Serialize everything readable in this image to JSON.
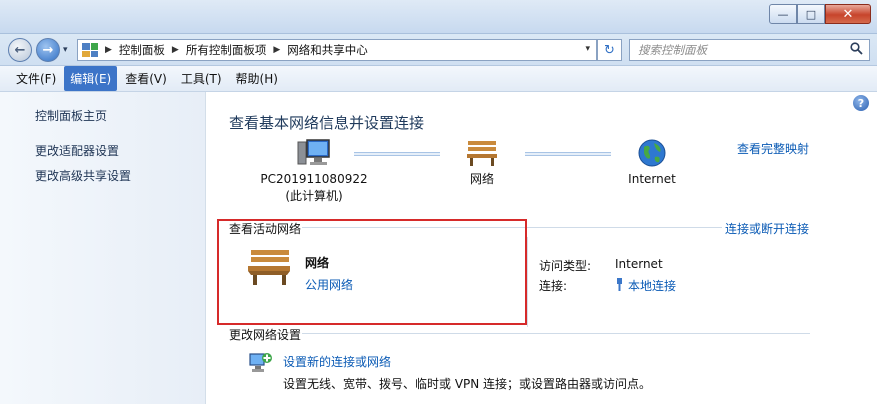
{
  "window": {
    "minimize": "—",
    "maximize": "□",
    "close": "✕"
  },
  "nav": {
    "back": "←",
    "forward": "→",
    "dropdown": "▾",
    "address_dropdown": "▾",
    "refresh": "↻",
    "breadcrumbs": [
      "控制面板",
      "所有控制面板项",
      "网络和共享中心"
    ],
    "separator": "▶",
    "search_placeholder": "搜索控制面板"
  },
  "menu": [
    "文件(F)",
    "编辑(E)",
    "查看(V)",
    "工具(T)",
    "帮助(H)"
  ],
  "sidebar": {
    "items": [
      "控制面板主页",
      "更改适配器设置",
      "更改高级共享设置"
    ]
  },
  "main": {
    "help": "?",
    "title": "查看基本网络信息并设置连接",
    "full_map": "查看完整映射",
    "map": {
      "computer_name": "PC201911080922",
      "computer_sub": "(此计算机)",
      "network": "网络",
      "internet": "Internet"
    },
    "active": {
      "title": "查看活动网络",
      "connect_link": "连接或断开连接",
      "name": "网络",
      "type": "公用网络",
      "access_label": "访问类型:",
      "access_value": "Internet",
      "conn_label": "连接:",
      "conn_value": "本地连接"
    },
    "change": {
      "title": "更改网络设置",
      "task_link": "设置新的连接或网络",
      "task_desc": "设置无线、宽带、拨号、临时或 VPN 连接；或设置路由器或访问点。"
    }
  },
  "colors": {
    "link": "#0b5bb5",
    "highlight_box": "#d62a2a",
    "menu_active": "#3c74c8"
  }
}
